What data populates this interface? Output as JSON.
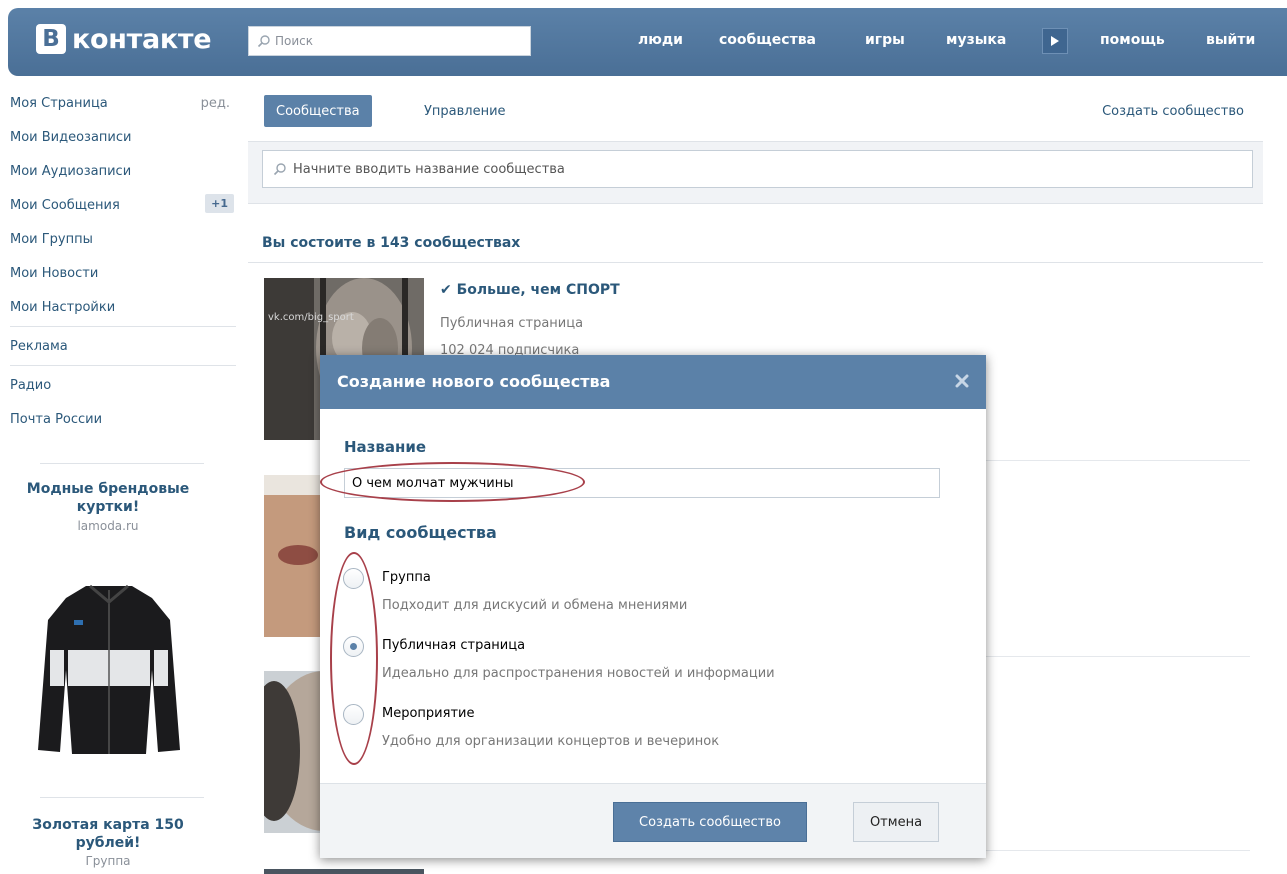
{
  "header": {
    "logo_letter": "В",
    "logo_text": "контакте",
    "search_placeholder": "Поиск",
    "nav": [
      "люди",
      "сообщества",
      "игры",
      "музыка",
      "помощь",
      "выйти"
    ]
  },
  "sidebar": {
    "items": [
      {
        "label": "Моя Страница"
      },
      {
        "label": "Мои Видеозаписи"
      },
      {
        "label": "Мои Аудиозаписи"
      },
      {
        "label": "Мои Сообщения"
      },
      {
        "label": "Мои Группы"
      },
      {
        "label": "Мои Новости"
      },
      {
        "label": "Мои Настройки"
      },
      {
        "label": "Реклама"
      },
      {
        "label": "Радио"
      },
      {
        "label": "Почта России"
      }
    ],
    "edit_label": "ред.",
    "messages_badge": "+1",
    "ad1": {
      "title": "Модные брендовые куртки!",
      "domain": "lamoda.ru"
    },
    "ad2": {
      "title": "Золотая карта 150 рублей!",
      "subtitle": "Группа"
    }
  },
  "main": {
    "tab_active": "Сообщества",
    "tab_manage": "Управление",
    "create_link": "Создать сообщество",
    "group_search_placeholder": "Начните вводить название сообщества",
    "count_header": "Вы состоите в 143 сообществах",
    "group1": {
      "name": "✔ Больше, чем СПОРТ",
      "type": "Публичная страница",
      "subs": "102 024 подписчика",
      "watermark": "vk.com/big_sport"
    }
  },
  "modal": {
    "title": "Создание нового сообщества",
    "name_label": "Название",
    "name_value": "О чем молчат мужчины",
    "type_label": "Вид сообщества",
    "options": [
      {
        "title": "Группа",
        "desc": "Подходит для дискусий и обмена мнениями",
        "checked": false
      },
      {
        "title": "Публичная страница",
        "desc": "Идеально для распространения новостей и информации",
        "checked": true
      },
      {
        "title": "Мероприятие",
        "desc": "Удобно для организации концертов и вечеринок",
        "checked": false
      }
    ],
    "create_button": "Создать сообщество",
    "cancel_button": "Отмена"
  },
  "colors": {
    "accent": "#5b81a8",
    "link": "#2b587a",
    "annotation": "#a8404a"
  }
}
